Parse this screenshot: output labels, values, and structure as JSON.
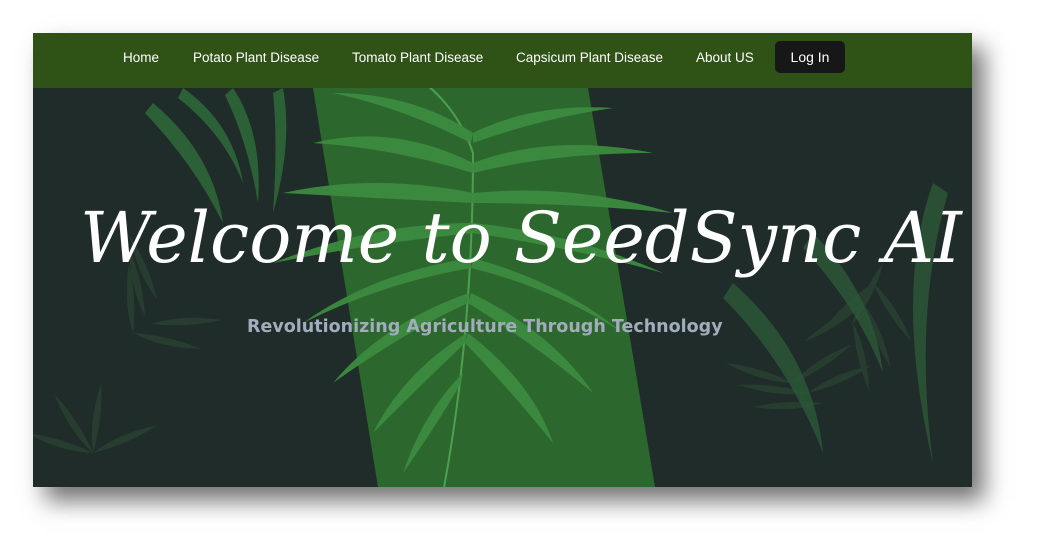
{
  "nav": {
    "items": [
      {
        "label": "Home"
      },
      {
        "label": "Potato Plant Disease"
      },
      {
        "label": "Tomato Plant Disease"
      },
      {
        "label": "Capsicum Plant Disease"
      },
      {
        "label": "About US"
      }
    ],
    "login_label": "Log In"
  },
  "hero": {
    "title": "Welcome to SeedSync AI",
    "subtitle": "Revolutionizing Agriculture Through Technology"
  },
  "colors": {
    "navbar": "#2f5217",
    "background": "#1e2b28",
    "accent_band": "#2f7a31",
    "login_button": "#171717",
    "subtitle_text": "#a3acbc"
  },
  "icons": {
    "background_art": "fern-leaves-illustration"
  }
}
